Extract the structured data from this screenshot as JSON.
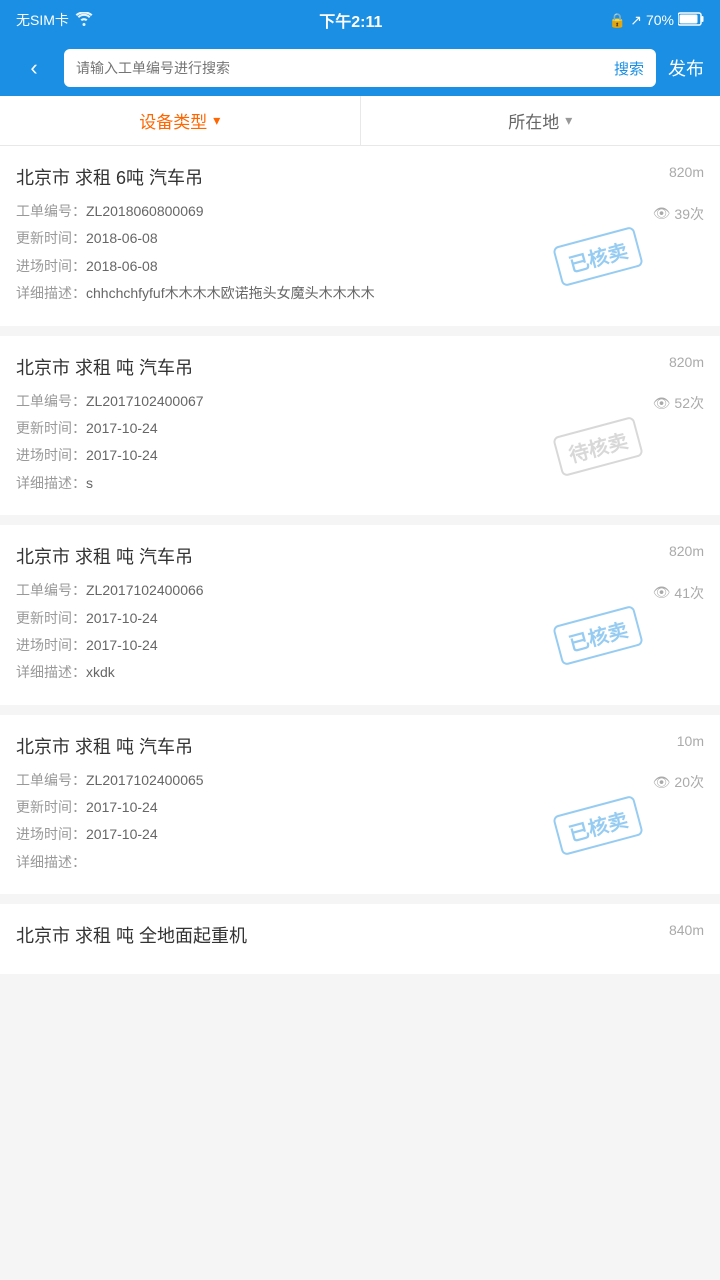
{
  "statusBar": {
    "left": "无SIM卡 ▲",
    "center": "下午2:11",
    "right": "70%"
  },
  "navBar": {
    "backLabel": "‹",
    "searchPlaceholder": "请输入工单编号进行搜索",
    "searchButtonLabel": "搜索",
    "publishLabel": "发布"
  },
  "filters": [
    {
      "label": "设备类型",
      "active": true
    },
    {
      "label": "所在地",
      "active": false
    }
  ],
  "cards": [
    {
      "title": "北京市 求租 6吨 汽车吊",
      "distance": "820m",
      "workOrderLabel": "工单编号：",
      "workOrderNo": "ZL2018060800069",
      "views": "39次",
      "updateLabel": "更新时间：",
      "updateDate": "2018-06-08",
      "entryLabel": "进场时间：",
      "entryDate": "2018-06-08",
      "descLabel": "详细描述：",
      "desc": "chhchchfyfuf木木木木欧诺拖头女魔头木木木木",
      "stamp": "已核卖",
      "stampType": "sold"
    },
    {
      "title": "北京市 求租 吨 汽车吊",
      "distance": "820m",
      "workOrderLabel": "工单编号：",
      "workOrderNo": "ZL2017102400067",
      "views": "52次",
      "updateLabel": "更新时间：",
      "updateDate": "2017-10-24",
      "entryLabel": "进场时间：",
      "entryDate": "2017-10-24",
      "descLabel": "详细描述：",
      "desc": "s",
      "stamp": "待核卖",
      "stampType": "pending"
    },
    {
      "title": "北京市 求租 吨 汽车吊",
      "distance": "820m",
      "workOrderLabel": "工单编号：",
      "workOrderNo": "ZL2017102400066",
      "views": "41次",
      "updateLabel": "更新时间：",
      "updateDate": "2017-10-24",
      "entryLabel": "进场时间：",
      "entryDate": "2017-10-24",
      "descLabel": "详细描述：",
      "desc": "xkdk",
      "stamp": "已核卖",
      "stampType": "sold"
    },
    {
      "title": "北京市 求租 吨 汽车吊",
      "distance": "10m",
      "workOrderLabel": "工单编号：",
      "workOrderNo": "ZL2017102400065",
      "views": "20次",
      "updateLabel": "更新时间：",
      "updateDate": "2017-10-24",
      "entryLabel": "进场时间：",
      "entryDate": "2017-10-24",
      "descLabel": "详细描述：",
      "desc": "",
      "stamp": "已核卖",
      "stampType": "sold"
    },
    {
      "title": "北京市 求租 吨 全地面起重机",
      "distance": "840m",
      "workOrderLabel": "",
      "workOrderNo": "",
      "views": "",
      "updateLabel": "",
      "updateDate": "",
      "entryLabel": "",
      "entryDate": "",
      "descLabel": "",
      "desc": "",
      "stamp": "",
      "stampType": ""
    }
  ]
}
